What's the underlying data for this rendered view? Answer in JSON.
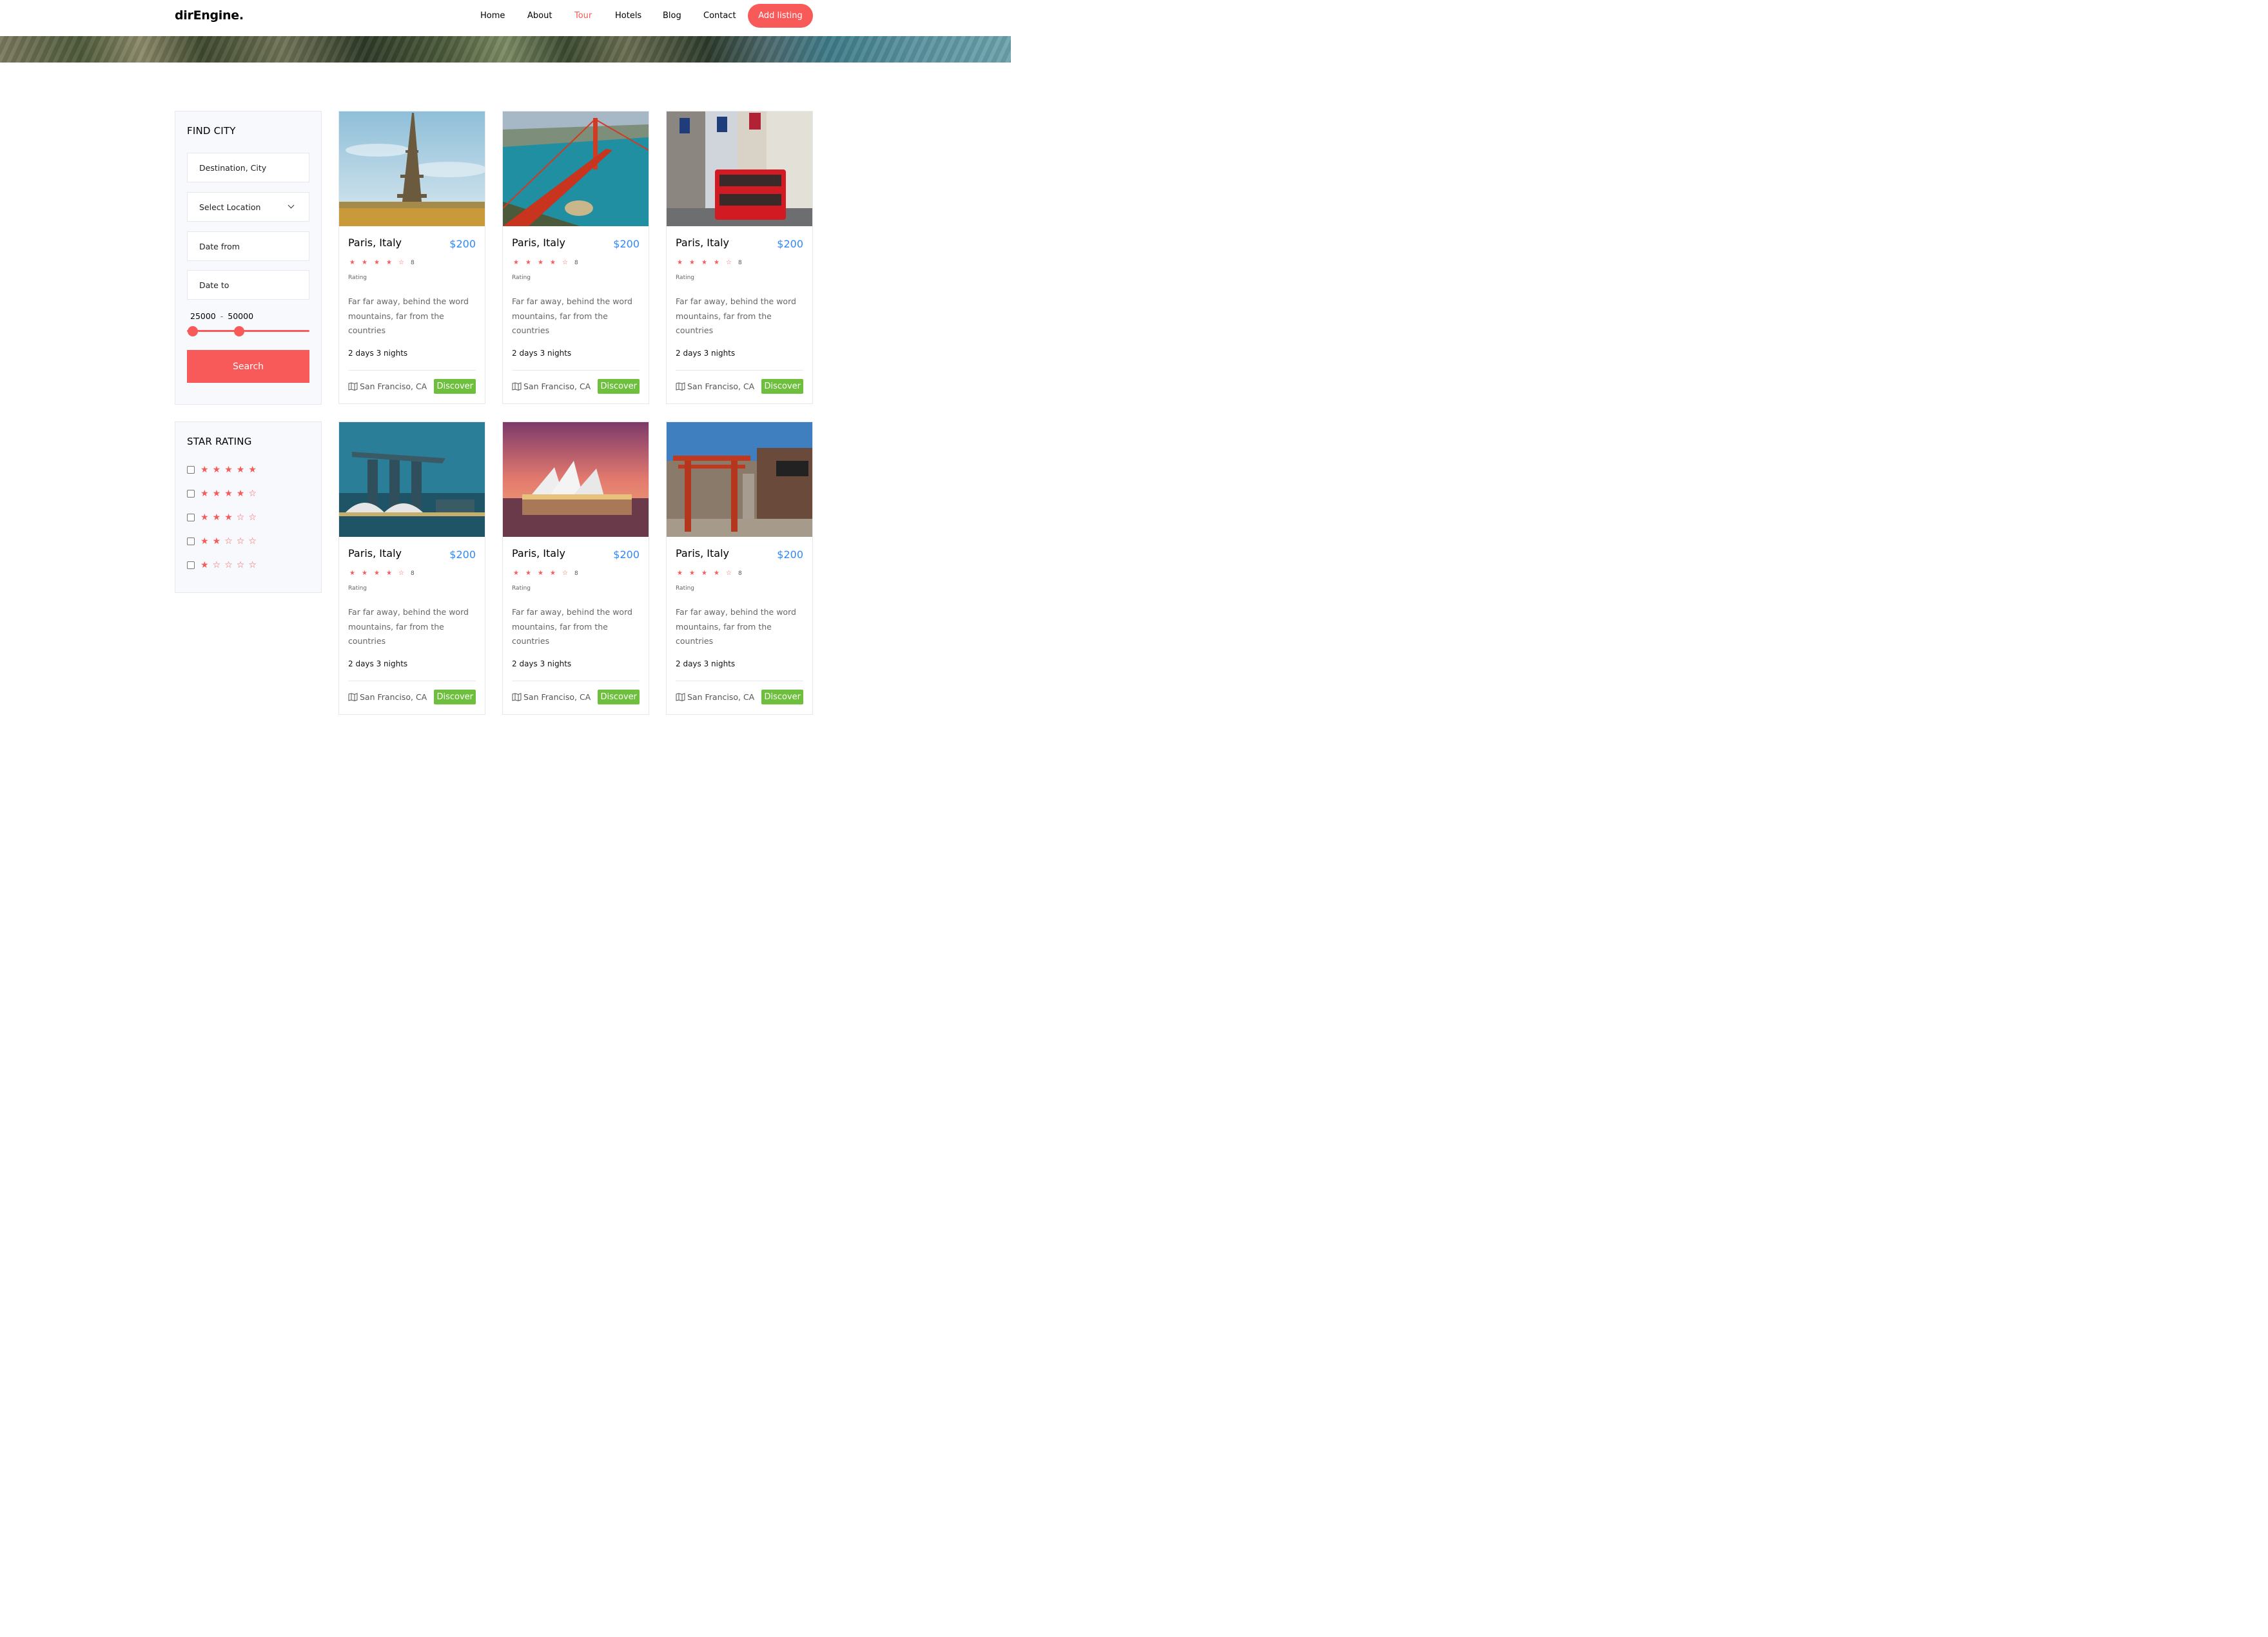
{
  "nav": {
    "logo": "dirEngine.",
    "items": [
      "Home",
      "About",
      "Tour",
      "Hotels",
      "Blog",
      "Contact"
    ],
    "active": "Tour",
    "cta": "Add listing"
  },
  "find_city": {
    "title": "FIND CITY",
    "destination_placeholder": "Destination, City",
    "location_select": "Select Location",
    "date_from": "Date from",
    "date_to": "Date to",
    "range_min": "25000",
    "range_sep": "-",
    "range_max": "50000",
    "search_label": "Search"
  },
  "star_rating": {
    "title": "STAR RATING",
    "options": [
      {
        "filled": 5
      },
      {
        "filled": 4
      },
      {
        "filled": 3
      },
      {
        "filled": 2
      },
      {
        "filled": 1
      }
    ]
  },
  "cards": [
    {
      "image": "eiffel-tower-photo",
      "title": "Paris, Italy",
      "price": "$200",
      "stars": 4,
      "count": "8",
      "rating_label": "Rating",
      "desc": "Far far away, behind the word mountains, far from the countries",
      "duration": "2 days 3 nights",
      "location": "San Franciso, CA",
      "cta": "Discover"
    },
    {
      "image": "golden-gate-bridge-photo",
      "title": "Paris, Italy",
      "price": "$200",
      "stars": 4,
      "count": "8",
      "rating_label": "Rating",
      "desc": "Far far away, behind the word mountains, far from the countries",
      "duration": "2 days 3 nights",
      "location": "San Franciso, CA",
      "cta": "Discover"
    },
    {
      "image": "london-street-bus-photo",
      "title": "Paris, Italy",
      "price": "$200",
      "stars": 4,
      "count": "8",
      "rating_label": "Rating",
      "desc": "Far far away, behind the word mountains, far from the countries",
      "duration": "2 days 3 nights",
      "location": "San Franciso, CA",
      "cta": "Discover"
    },
    {
      "image": "marina-bay-sands-photo",
      "title": "Paris, Italy",
      "price": "$200",
      "stars": 4,
      "count": "8",
      "rating_label": "Rating",
      "desc": "Far far away, behind the word mountains, far from the countries",
      "duration": "2 days 3 nights",
      "location": "San Franciso, CA",
      "cta": "Discover"
    },
    {
      "image": "sydney-opera-house-photo",
      "title": "Paris, Italy",
      "price": "$200",
      "stars": 4,
      "count": "8",
      "rating_label": "Rating",
      "desc": "Far far away, behind the word mountains, far from the countries",
      "duration": "2 days 3 nights",
      "location": "San Franciso, CA",
      "cta": "Discover"
    },
    {
      "image": "japan-torii-street-photo",
      "title": "Paris, Italy",
      "price": "$200",
      "stars": 4,
      "count": "8",
      "rating_label": "Rating",
      "desc": "Far far away, behind the word mountains, far from the countries",
      "duration": "2 days 3 nights",
      "location": "San Franciso, CA",
      "cta": "Discover"
    }
  ],
  "colors": {
    "accent": "#f85959",
    "price": "#2f89fc",
    "discover": "#6fbf3e",
    "sidebar_bg": "#f8f9fd"
  }
}
